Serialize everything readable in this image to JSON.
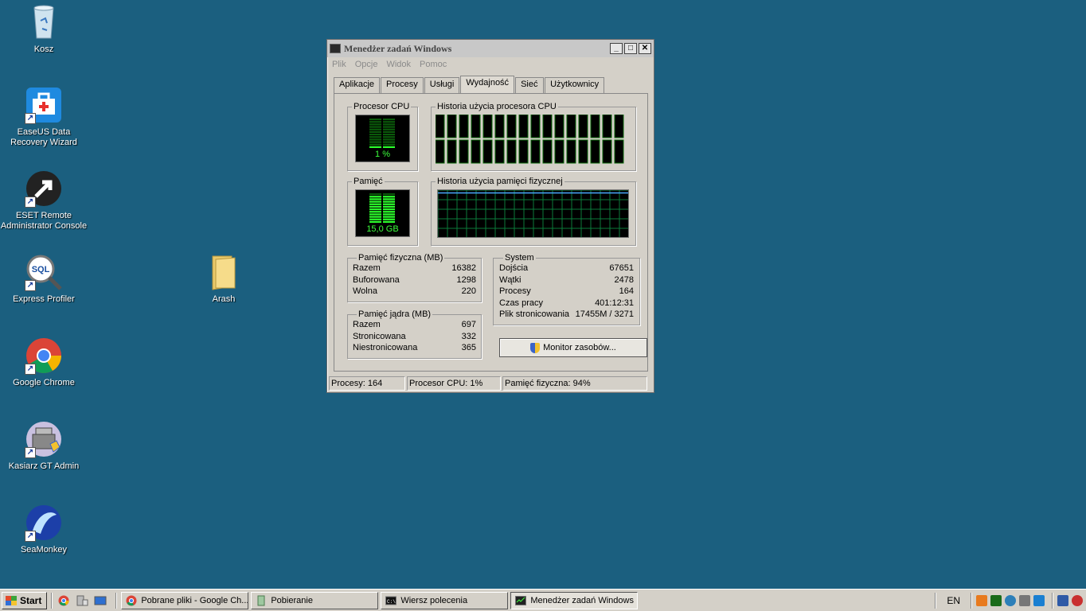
{
  "desktop": {
    "icons": [
      {
        "label": "Kosz"
      },
      {
        "label": "EaseUS Data\nRecovery Wizard"
      },
      {
        "label": "ESET Remote\nAdministrator Console"
      },
      {
        "label": "Express Profiler"
      },
      {
        "label": "Google Chrome"
      },
      {
        "label": "Kasiarz GT Admin"
      },
      {
        "label": "SeaMonkey"
      },
      {
        "label": "Arash"
      }
    ]
  },
  "window": {
    "title": "Menedżer zadań Windows",
    "menu": [
      "Plik",
      "Opcje",
      "Widok",
      "Pomoc"
    ],
    "tabs": [
      "Aplikacje",
      "Procesy",
      "Usługi",
      "Wydajność",
      "Sieć",
      "Użytkownicy"
    ],
    "active_tab": "Wydajność",
    "cpu": {
      "legend": "Procesor CPU",
      "value": "1 %",
      "level": 0.01
    },
    "cpu_history": {
      "legend": "Historia użycia procesora CPU"
    },
    "memory": {
      "legend": "Pamięć",
      "value": "15,0 GB",
      "level": 0.94
    },
    "memory_history": {
      "legend": "Historia użycia pamięci fizycznej"
    },
    "physical_memory": {
      "legend": "Pamięć fizyczna (MB)",
      "rows": [
        {
          "label": "Razem",
          "value": "16382"
        },
        {
          "label": "Buforowana",
          "value": "1298"
        },
        {
          "label": "Wolna",
          "value": "220"
        }
      ]
    },
    "kernel_memory": {
      "legend": "Pamięć jądra (MB)",
      "rows": [
        {
          "label": "Razem",
          "value": "697"
        },
        {
          "label": "Stronicowana",
          "value": "332"
        },
        {
          "label": "Niestronicowana",
          "value": "365"
        }
      ]
    },
    "system": {
      "legend": "System",
      "rows": [
        {
          "label": "Dojścia",
          "value": "67651"
        },
        {
          "label": "Wątki",
          "value": "2478"
        },
        {
          "label": "Procesy",
          "value": "164"
        },
        {
          "label": "Czas pracy",
          "value": "401:12:31"
        },
        {
          "label": "Plik stronicowania",
          "value": "17455M / 3271"
        }
      ]
    },
    "resource_monitor_button": "Monitor zasobów...",
    "status": {
      "processes": "Procesy: 164",
      "cpu": "Procesor CPU: 1%",
      "memory": "Pamięć fizyczna: 94%"
    }
  },
  "taskbar": {
    "start": "Start",
    "tasks": [
      {
        "label": "Pobrane pliki - Google Ch..."
      },
      {
        "label": "Pobieranie"
      },
      {
        "label": "Wiersz polecenia"
      },
      {
        "label": "Menedżer zadań Windows"
      }
    ],
    "language": "EN"
  }
}
